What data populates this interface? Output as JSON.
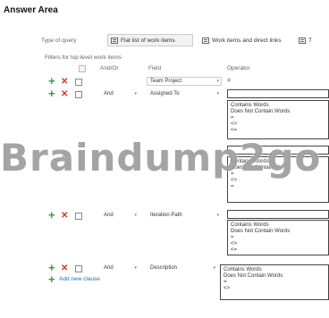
{
  "answer_area_label": "Answer Area",
  "type_of_query_label": "Type of query",
  "tabs": [
    {
      "label": "Flat list of work items"
    },
    {
      "label": "Work items and direct links"
    },
    {
      "label": "T"
    }
  ],
  "filters_label": "Filters for top level work items",
  "columns": {
    "andor": "And/Or",
    "field": "Field",
    "operator": "Operator"
  },
  "rows": [
    {
      "andor": "",
      "field": "Team Project",
      "operator": "="
    },
    {
      "andor": "And",
      "field": "Assigned To",
      "operator": ""
    },
    {
      "andor": "And",
      "field": "",
      "operator": ""
    },
    {
      "andor": "And",
      "field": "Iteration Path",
      "operator": ""
    },
    {
      "andor": "And",
      "field": "Description",
      "operator": ""
    }
  ],
  "operator_lists": [
    "Contains Words\nDoes Not Contain Words\n=\n<>\n<=",
    "Contains Words\nDoes Not Contain W\n=\n<>\n=",
    "Contains Words\nDoes Not Contain Words\n=\n<>\n<=",
    "Contains Words\nDoes Not Contain Words\n=\n<>"
  ],
  "add_new_clause": "Add new clause",
  "watermark": "Braindump2go",
  "icons": {
    "add": "plus-icon",
    "remove": "x-icon"
  },
  "colors": {
    "add": "#3a9b3a",
    "remove": "#d03a2a",
    "link": "#1f6fb5"
  }
}
